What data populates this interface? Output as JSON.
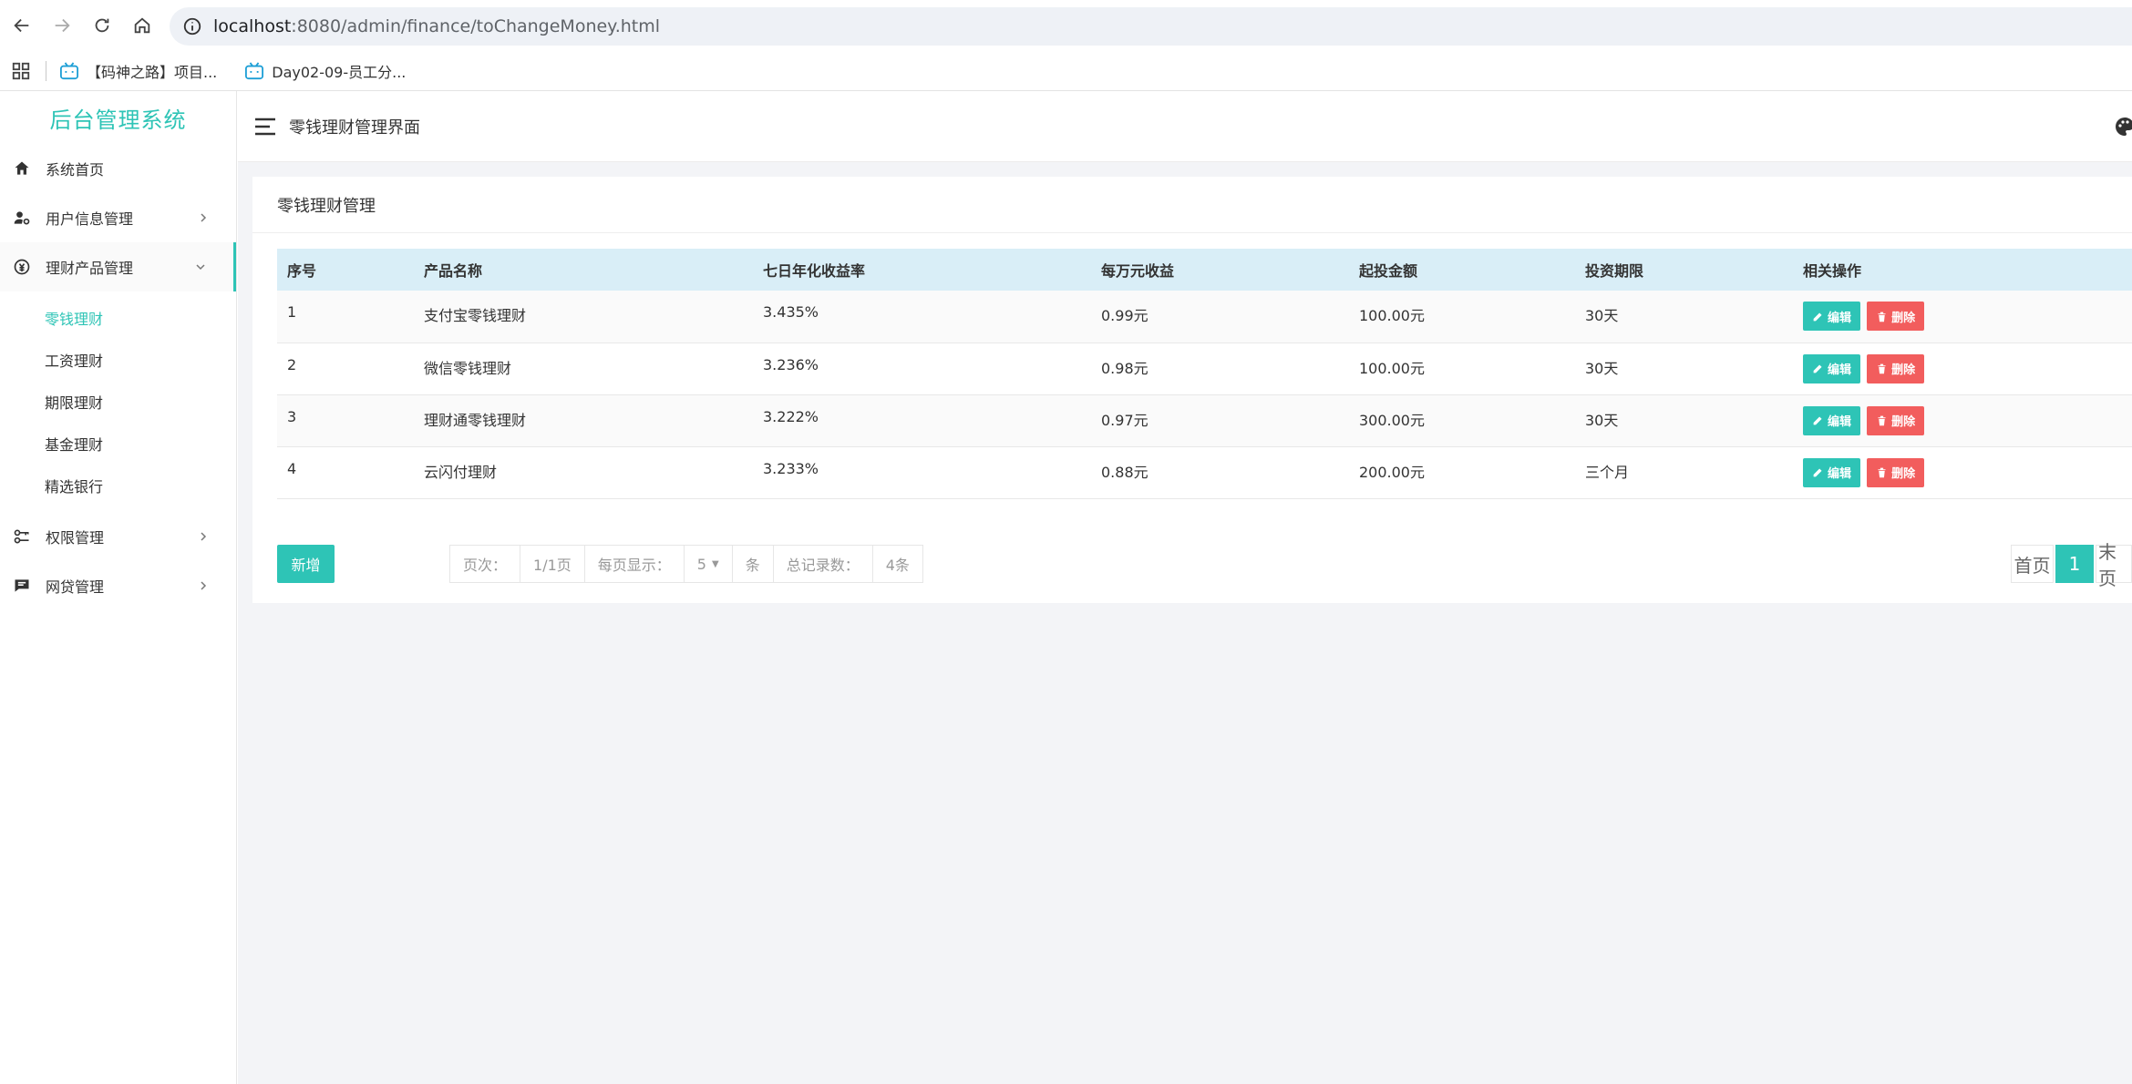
{
  "browser": {
    "url_host": "localhost",
    "url_path": ":8080/admin/finance/toChangeMoney.html",
    "bookmarks": [
      {
        "label": "【码神之路】项目..."
      },
      {
        "label": "Day02-09-员工分..."
      }
    ]
  },
  "sidebar": {
    "brand": "后台管理系统",
    "items": [
      {
        "label": "系统首页",
        "icon": "home-icon"
      },
      {
        "label": "用户信息管理",
        "icon": "user-settings-icon"
      },
      {
        "label": "理财产品管理",
        "icon": "finance-icon"
      },
      {
        "label": "权限管理",
        "icon": "key-icon"
      },
      {
        "label": "网贷管理",
        "icon": "loan-icon"
      }
    ],
    "submenu": [
      {
        "label": "零钱理财",
        "active": true
      },
      {
        "label": "工资理财"
      },
      {
        "label": "期限理财"
      },
      {
        "label": "基金理财"
      },
      {
        "label": "精选银行"
      }
    ]
  },
  "topbar": {
    "title": "零钱理财管理界面"
  },
  "card": {
    "title": "零钱理财管理"
  },
  "table": {
    "headers": [
      "序号",
      "产品名称",
      "七日年化收益率",
      "每万元收益",
      "起投金额",
      "投资期限",
      "相关操作"
    ],
    "edit_label": "编辑",
    "delete_label": "删除",
    "rows": [
      {
        "id": "1",
        "name": "支付宝零钱理财",
        "rate": "3.435%",
        "income": "0.99元",
        "min": "100.00元",
        "term": "30天"
      },
      {
        "id": "2",
        "name": "微信零钱理财",
        "rate": "3.236%",
        "income": "0.98元",
        "min": "100.00元",
        "term": "30天"
      },
      {
        "id": "3",
        "name": "理财通零钱理财",
        "rate": "3.222%",
        "income": "0.97元",
        "min": "300.00元",
        "term": "30天"
      },
      {
        "id": "4",
        "name": "云闪付理财",
        "rate": "3.233%",
        "income": "0.88元",
        "min": "200.00元",
        "term": "三个月"
      }
    ]
  },
  "footer": {
    "add_label": "新增",
    "page_label": "页次：",
    "page_value": "1/1页",
    "per_page_label": "每页显示：",
    "per_page_value": "5",
    "unit": "条",
    "total_label": "总记录数：",
    "total_value": "4条",
    "first_label": "首页",
    "current_page": "1",
    "last_label": "末页"
  },
  "colors": {
    "accent": "#2ec4b6",
    "danger": "#f25d5d",
    "table_header_bg": "#d9eef7"
  }
}
